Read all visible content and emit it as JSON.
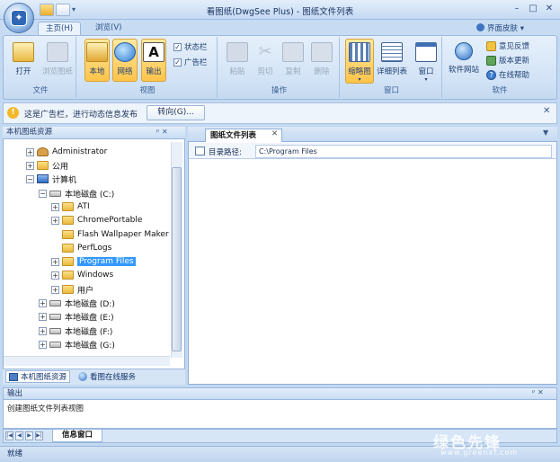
{
  "window": {
    "title": "看图纸(DwgSee Plus) - 图纸文件列表",
    "skin_label": "界面皮肤"
  },
  "ribbon": {
    "tabs": [
      {
        "label": "主页(H)"
      },
      {
        "label": "浏览(V)"
      }
    ],
    "groups": {
      "file": {
        "label": "文件",
        "open": "打开",
        "browse_history": "浏览图纸"
      },
      "view": {
        "label": "视图",
        "local": "本地",
        "network": "网络",
        "output": "输出",
        "statusbar": "状态栏",
        "adbar": "广告栏"
      },
      "operation": {
        "label": "操作",
        "paste": "粘贴",
        "cut": "剪切",
        "copy": "复制",
        "delete": "删除"
      },
      "window": {
        "label": "窗口",
        "thumbnail": "缩略图",
        "detail_list": "详细列表",
        "window_menu": "窗口"
      },
      "software": {
        "label": "软件",
        "website": "软件网站",
        "feedback": "意见反馈",
        "update": "版本更新",
        "help": "在线帮助"
      }
    }
  },
  "infobar": {
    "text": "这是广告栏，进行动态信息发布",
    "redirect": "转向(G)..."
  },
  "left_panel": {
    "title": "本机图纸资源",
    "tree": [
      {
        "label": "Administrator"
      },
      {
        "label": "公用"
      },
      {
        "label": "计算机"
      },
      {
        "label": "本地磁盘 (C:)"
      },
      {
        "label": "ATI"
      },
      {
        "label": "ChromePortable"
      },
      {
        "label": "Flash Wallpaper Maker"
      },
      {
        "label": "PerfLogs"
      },
      {
        "label": "Program Files"
      },
      {
        "label": "Windows"
      },
      {
        "label": "用户"
      },
      {
        "label": "本地磁盘 (D:)"
      },
      {
        "label": "本地磁盘 (E:)"
      },
      {
        "label": "本地磁盘 (F:)"
      },
      {
        "label": "本地磁盘 (G:)"
      }
    ],
    "tabs": [
      {
        "label": "本机图纸资源"
      },
      {
        "label": "看图在线服务"
      }
    ]
  },
  "right_panel": {
    "tab": "图纸文件列表",
    "path_label": "目录路径:",
    "path_value": "C:\\Program Files"
  },
  "output": {
    "title": "输出",
    "message": "创建图纸文件列表视图",
    "tab": "信息窗口"
  },
  "status": {
    "text": "就绪"
  },
  "watermark": {
    "text": "绿色先锋",
    "url": "www.greenxf.com"
  }
}
